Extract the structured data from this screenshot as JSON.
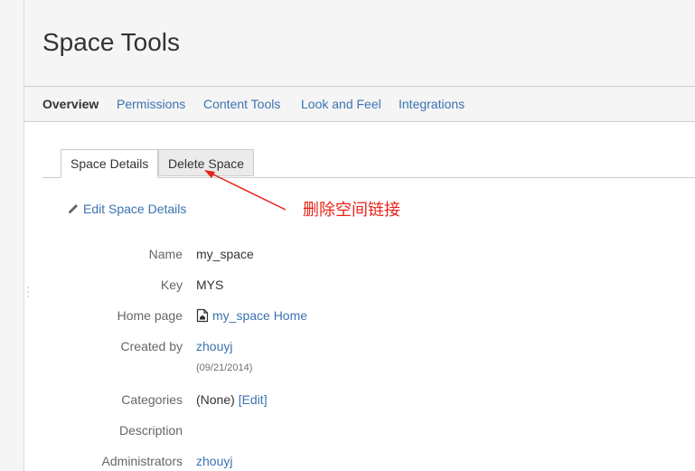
{
  "header": {
    "title": "Space Tools"
  },
  "nav": {
    "items": [
      {
        "label": "Overview",
        "active": true
      },
      {
        "label": "Permissions",
        "active": false
      },
      {
        "label": "Content Tools",
        "active": false
      },
      {
        "label": "Look and Feel",
        "active": false
      },
      {
        "label": "Integrations",
        "active": false
      }
    ]
  },
  "tabs": [
    {
      "label": "Space Details",
      "active": true
    },
    {
      "label": "Delete Space",
      "active": false
    }
  ],
  "edit": {
    "label": "Edit Space Details",
    "icon": "pencil-icon"
  },
  "annotation": {
    "text": "删除空间链接",
    "color": "#e8231a"
  },
  "details": {
    "name_label": "Name",
    "name_value": "my_space",
    "key_label": "Key",
    "key_value": "MYS",
    "home_label": "Home page",
    "home_value": "my_space Home",
    "home_icon": "home-page-icon",
    "created_label": "Created by",
    "created_value": "zhouyj",
    "created_date": "(09/21/2014)",
    "categories_label": "Categories",
    "categories_value": "(None)",
    "categories_edit": "[Edit]",
    "description_label": "Description",
    "administrators_label": "Administrators",
    "administrators_value": "zhouyj"
  },
  "colors": {
    "link": "#3b73af",
    "header_bg": "#f5f5f5",
    "annotation": "#e8231a"
  }
}
